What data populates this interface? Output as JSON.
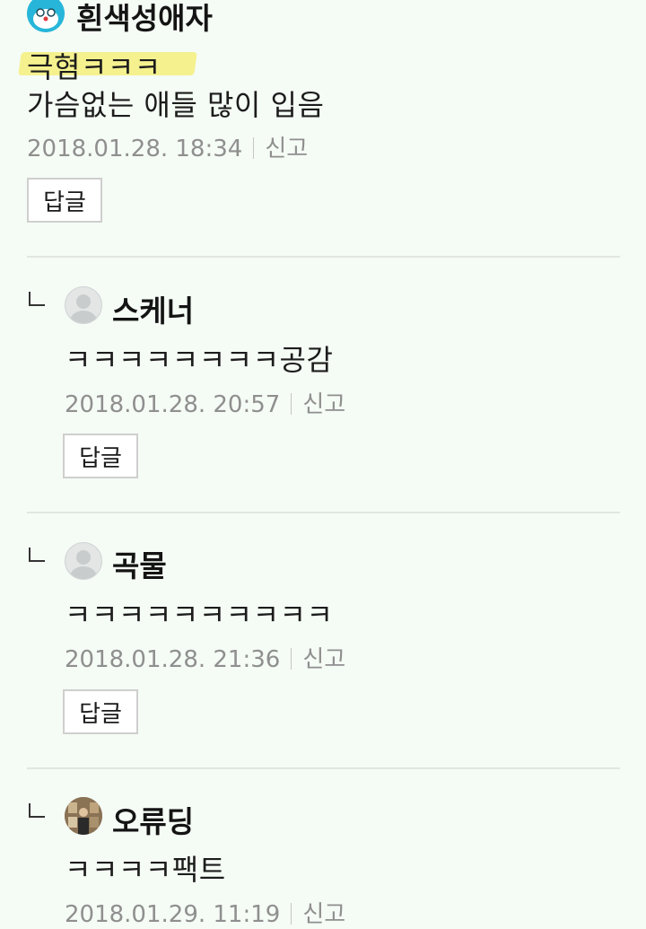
{
  "comments": [
    {
      "author": "흰색성애자",
      "avatar": "blue-character-icon",
      "highlight_text": "극혐ㅋㅋㅋ",
      "text": "가슴없는 애들 많이 입음",
      "date": "2018.01.28. 18:34",
      "report_label": "신고",
      "reply_label": "답글"
    },
    {
      "author": "스케너",
      "avatar": "default-user-icon",
      "text": "ㅋㅋㅋㅋㅋㅋㅋㅋ공감",
      "date": "2018.01.28. 20:57",
      "report_label": "신고",
      "reply_label": "답글"
    },
    {
      "author": "곡물",
      "avatar": "default-user-icon",
      "text": "ㅋㅋㅋㅋㅋㅋㅋㅋㅋㅋ",
      "date": "2018.01.28. 21:36",
      "report_label": "신고",
      "reply_label": "답글"
    },
    {
      "author": "오류딩",
      "avatar": "photo-user-icon",
      "text": "ㅋㅋㅋㅋ팩트",
      "date": "2018.01.29. 11:19",
      "report_label": "신고"
    }
  ],
  "colors": {
    "background": "#f5fbf5",
    "highlight": "#f4ee7c",
    "meta_text": "#8f8f8f"
  }
}
